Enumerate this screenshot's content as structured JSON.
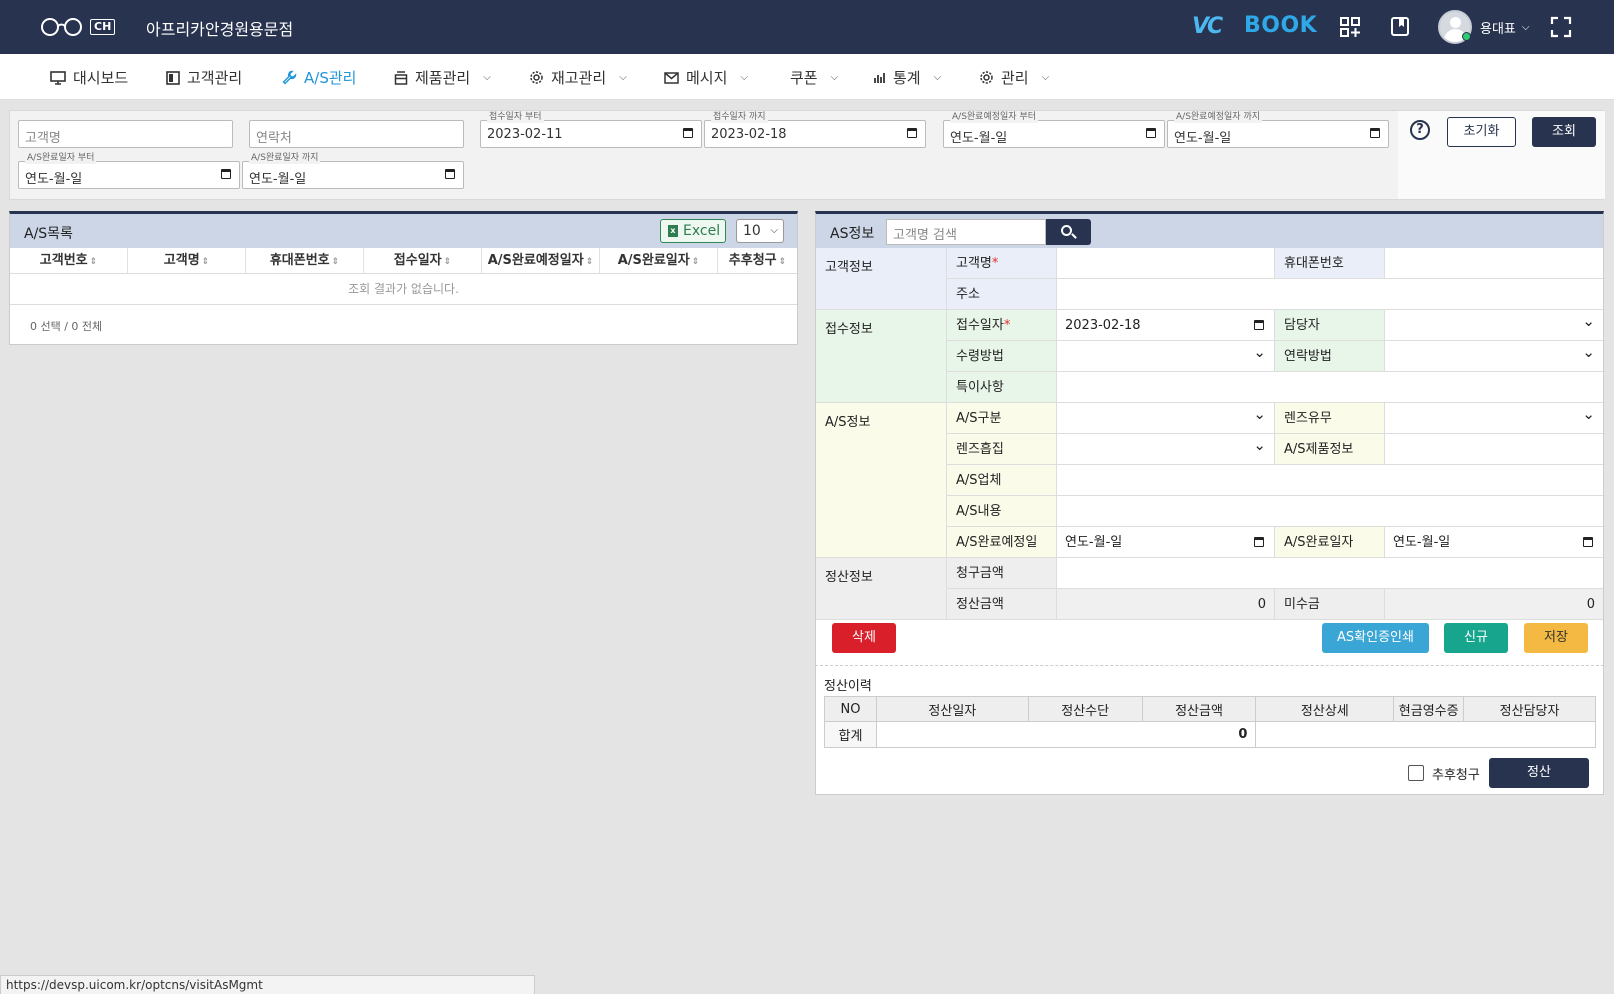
{
  "header": {
    "logo_badge": "CH",
    "shop_name": "아프리카안경원용문점",
    "brand_vc": "VC",
    "brand_book": "BOOK",
    "user_name": "용대표",
    "colors": {
      "topbar": "#283350",
      "accent": "#2196d8",
      "brand": "#2fa8e8"
    }
  },
  "menu": [
    {
      "label": "대시보드",
      "icon": "monitor-icon",
      "dropdown": false
    },
    {
      "label": "고객관리",
      "icon": "book-icon",
      "dropdown": false
    },
    {
      "label": "A/S관리",
      "icon": "wrench-icon",
      "dropdown": false,
      "active": true
    },
    {
      "label": "제품관리",
      "icon": "box-icon",
      "dropdown": true
    },
    {
      "label": "재고관리",
      "icon": "gear-icon",
      "dropdown": true
    },
    {
      "label": "메시지",
      "icon": "mail-icon",
      "dropdown": true
    },
    {
      "label": "쿠폰",
      "icon": "",
      "dropdown": true
    },
    {
      "label": "통계",
      "icon": "bar-chart-icon",
      "dropdown": true
    },
    {
      "label": "관리",
      "icon": "gear-icon",
      "dropdown": true
    }
  ],
  "search": {
    "customer_name_ph": "고객명",
    "contact_ph": "연락처",
    "recv_from_label": "접수일자 부터",
    "recv_from": "2023-02-11",
    "recv_to_label": "접수일자 까지",
    "recv_to": "2023-02-18",
    "due_from_label": "A/S완료예정일자 부터",
    "due_from": "연도-월-일",
    "due_to_label": "A/S완료예정일자 까지",
    "due_to": "연도-월-일",
    "done_from_label": "A/S완료일자 부터",
    "done_from": "연도-월-일",
    "done_to_label": "A/S완료일자 까지",
    "done_to": "연도-월-일",
    "help": "?",
    "reset_label": "초기화",
    "search_label": "조회"
  },
  "list": {
    "title": "A/S목록",
    "excel_label": "Excel",
    "page_size": "10",
    "columns": [
      "고객번호",
      "고객명",
      "휴대폰번호",
      "접수일자",
      "A/S완료예정일자",
      "A/S완료일자",
      "추후청구"
    ],
    "empty_text": "조회 결과가 없습니다.",
    "footer": "0 선택 / 0 전체"
  },
  "detail": {
    "title": "AS정보",
    "search_ph": "고객명 검색",
    "sections": {
      "customer": "고객정보",
      "reception": "접수정보",
      "as": "A/S정보",
      "settle": "정산정보"
    },
    "labels": {
      "customer_name": "고객명",
      "mobile": "휴대폰번호",
      "address": "주소",
      "recv_date": "접수일자",
      "manager": "담당자",
      "pickup": "수령방법",
      "contact_method": "연락방법",
      "remarks": "특이사항",
      "as_type": "A/S구분",
      "lens": "렌즈유무",
      "lens_collect": "렌즈흡집",
      "as_product": "A/S제품정보",
      "as_vendor": "A/S업체",
      "as_content": "A/S내용",
      "as_due": "A/S완료예정일자",
      "as_done": "A/S완료일자",
      "bill_amount": "청구금액",
      "settled_amount": "정산금액",
      "unpaid": "미수금"
    },
    "values": {
      "required_mark": "*",
      "recv_date": "2023-02-18",
      "as_due": "연도-월-일",
      "as_done": "연도-월-일",
      "settled_amount": "0",
      "unpaid": "0"
    },
    "buttons": {
      "delete": "삭제",
      "print": "AS확인증인쇄",
      "new": "신규",
      "save": "저장"
    },
    "history": {
      "title": "정산이력",
      "columns": [
        "NO",
        "정산일자",
        "정산수단",
        "정산금액",
        "정산상세",
        "현금영수증",
        "정산담당자"
      ],
      "total_label": "합계",
      "total_value": "0"
    },
    "later_bill_label": "추후청구",
    "settle_button": "정산"
  },
  "statusbar": {
    "url": "https://devsp.uicom.kr/optcns/visitAsMgmt"
  }
}
